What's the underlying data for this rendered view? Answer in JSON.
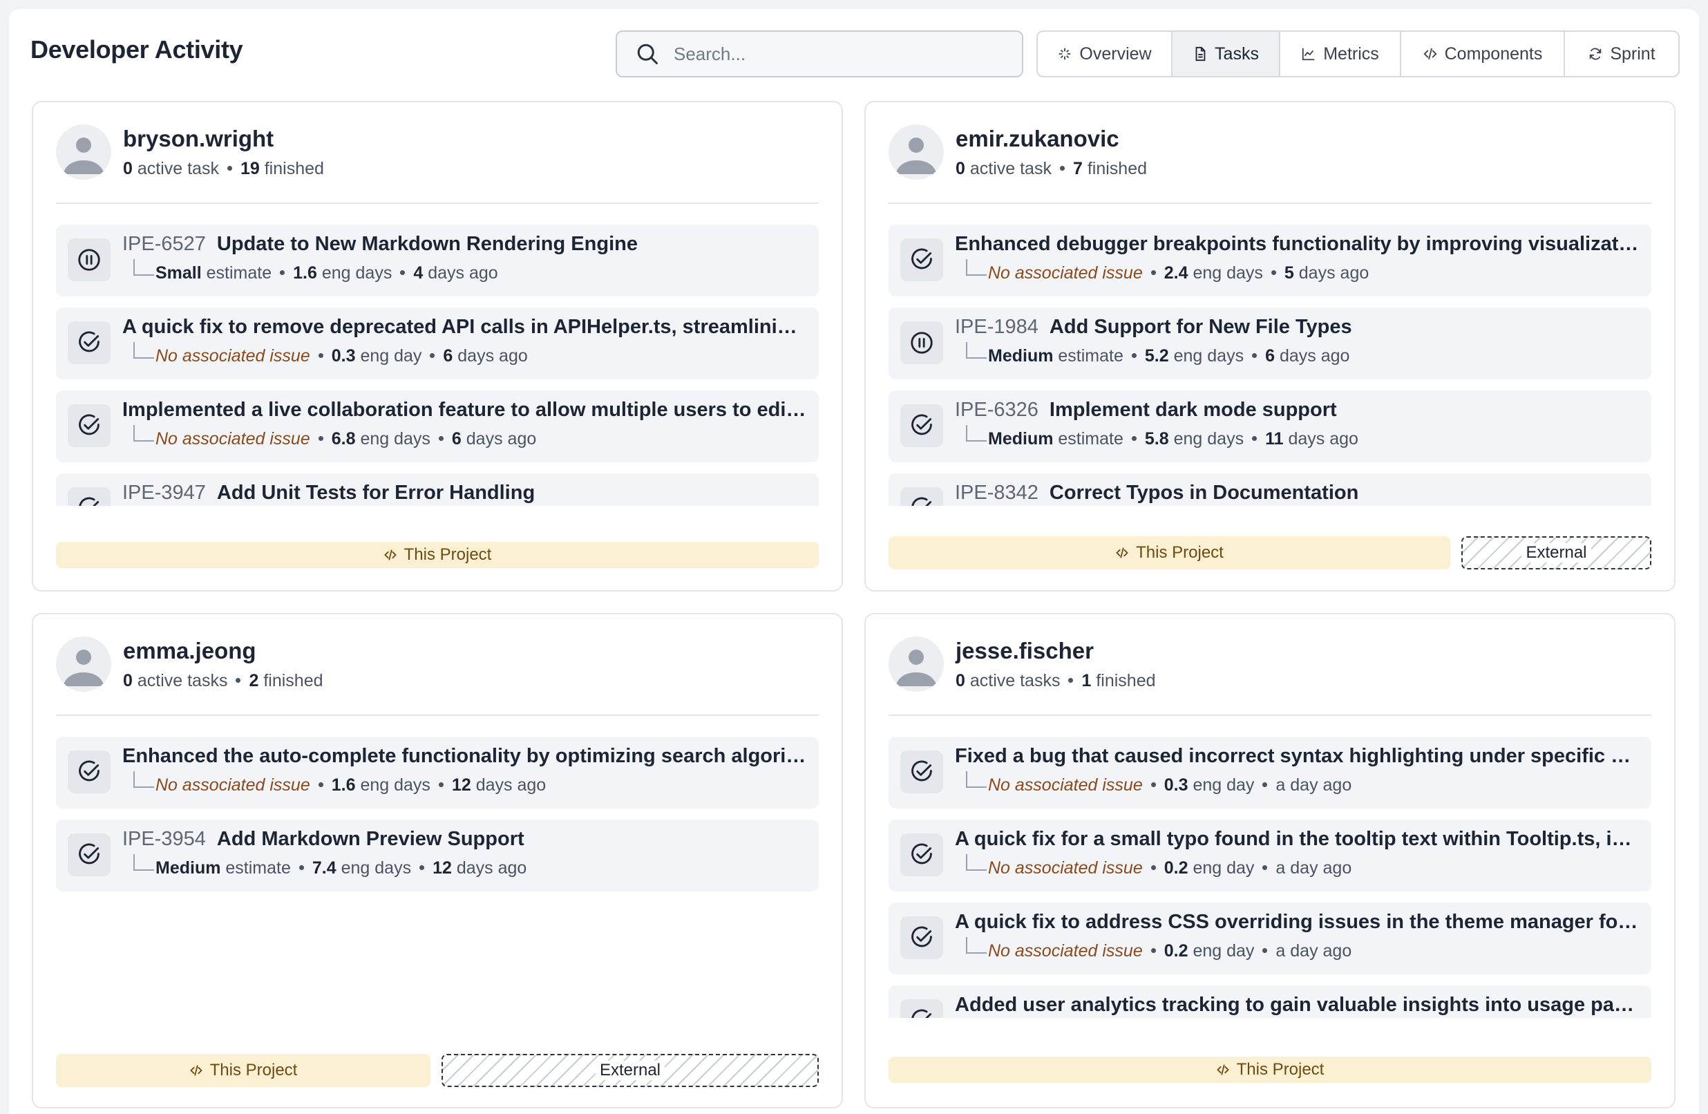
{
  "header": {
    "title": "Developer Activity",
    "search_placeholder": "Search...",
    "tabs": [
      {
        "label": "Overview",
        "icon": "sparkle-icon"
      },
      {
        "label": "Tasks",
        "icon": "document-icon",
        "active": true
      },
      {
        "label": "Metrics",
        "icon": "line-chart-icon"
      },
      {
        "label": "Components",
        "icon": "code-icon"
      },
      {
        "label": "Sprint",
        "icon": "refresh-icon"
      }
    ]
  },
  "colors": {
    "project_pill_bg": "#fcf0d3",
    "no_issue_text": "#8a4a1c",
    "task_bg": "#f2f4f7"
  },
  "project_label": "This Project",
  "external_label": "External",
  "developers": [
    {
      "name": "bryson.wright",
      "active_count": "0",
      "active_label": "active task",
      "finished_count": "19",
      "finished_label": "finished",
      "tasks": [
        {
          "status": "paused",
          "id": "IPE-6527",
          "title": "Update to New Markdown Rendering Engine",
          "issue": "Small",
          "issue_suffix": "estimate",
          "days": "1.6",
          "days_label": "eng days",
          "ago_num": "4",
          "ago_label": "days ago"
        },
        {
          "status": "done",
          "id": "",
          "title": "A quick fix to remove deprecated API calls in APIHelper.ts, streamlining communication with the backend",
          "issue": "No associated issue",
          "issue_suffix": "",
          "days": "0.3",
          "days_label": "eng day",
          "ago_num": "6",
          "ago_label": "days ago"
        },
        {
          "status": "done",
          "id": "",
          "title": "Implemented a live collaboration feature to allow multiple users to edit code simultaneously",
          "issue": "No associated issue",
          "issue_suffix": "",
          "days": "6.8",
          "days_label": "eng days",
          "ago_num": "6",
          "ago_label": "days ago"
        },
        {
          "status": "done",
          "id": "IPE-3947",
          "title": "Add Unit Tests for Error Handling",
          "issue": "",
          "issue_suffix": "",
          "days": "",
          "days_label": "",
          "ago_num": "",
          "ago_label": ""
        }
      ],
      "external": false
    },
    {
      "name": "emir.zukanovic",
      "active_count": "0",
      "active_label": "active task",
      "finished_count": "7",
      "finished_label": "finished",
      "tasks": [
        {
          "status": "done",
          "id": "",
          "title": "Enhanced debugger breakpoints functionality by improving visualization of conditions",
          "issue": "No associated issue",
          "issue_suffix": "",
          "days": "2.4",
          "days_label": "eng days",
          "ago_num": "5",
          "ago_label": "days ago"
        },
        {
          "status": "paused",
          "id": "IPE-1984",
          "title": "Add Support for New File Types",
          "issue": "Medium",
          "issue_suffix": "estimate",
          "days": "5.2",
          "days_label": "eng days",
          "ago_num": "6",
          "ago_label": "days ago"
        },
        {
          "status": "done",
          "id": "IPE-6326",
          "title": "Implement dark mode support",
          "issue": "Medium",
          "issue_suffix": "estimate",
          "days": "5.8",
          "days_label": "eng days",
          "ago_num": "11",
          "ago_label": "days ago"
        },
        {
          "status": "done",
          "id": "IPE-8342",
          "title": "Correct Typos in Documentation",
          "issue": "",
          "issue_suffix": "",
          "days": "",
          "days_label": "",
          "ago_num": "",
          "ago_label": ""
        }
      ],
      "external": true,
      "project_share": 0.75
    },
    {
      "name": "emma.jeong",
      "active_count": "0",
      "active_label": "active tasks",
      "finished_count": "2",
      "finished_label": "finished",
      "tasks": [
        {
          "status": "done",
          "id": "",
          "title": "Enhanced the auto-complete functionality by optimizing search algorithms for suggestions",
          "issue": "No associated issue",
          "issue_suffix": "",
          "days": "1.6",
          "days_label": "eng days",
          "ago_num": "12",
          "ago_label": "days ago"
        },
        {
          "status": "done",
          "id": "IPE-3954",
          "title": "Add Markdown Preview Support",
          "issue": "Medium",
          "issue_suffix": "estimate",
          "days": "7.4",
          "days_label": "eng days",
          "ago_num": "12",
          "ago_label": "days ago"
        }
      ],
      "external": true,
      "project_share": 0.5
    },
    {
      "name": "jesse.fischer",
      "active_count": "0",
      "active_label": "active tasks",
      "finished_count": "1",
      "finished_label": "finished",
      "tasks": [
        {
          "status": "done",
          "id": "",
          "title": "Fixed a bug that caused incorrect syntax highlighting under specific configurations",
          "issue": "No associated issue",
          "issue_suffix": "",
          "days": "0.3",
          "days_label": "eng day",
          "ago_num": "",
          "ago_label": "a day ago"
        },
        {
          "status": "done",
          "id": "",
          "title": "A quick fix for a small typo found in the tooltip text within Tooltip.ts, improving clarity",
          "issue": "No associated issue",
          "issue_suffix": "",
          "days": "0.2",
          "days_label": "eng day",
          "ago_num": "",
          "ago_label": "a day ago"
        },
        {
          "status": "done",
          "id": "",
          "title": "A quick fix to address CSS overriding issues in the theme manager for consistent styling",
          "issue": "No associated issue",
          "issue_suffix": "",
          "days": "0.2",
          "days_label": "eng day",
          "ago_num": "",
          "ago_label": "a day ago"
        },
        {
          "status": "done",
          "id": "",
          "title": "Added user analytics tracking to gain valuable insights into usage patterns",
          "issue": "",
          "issue_suffix": "",
          "days": "",
          "days_label": "",
          "ago_num": "",
          "ago_label": ""
        }
      ],
      "external": false
    }
  ]
}
